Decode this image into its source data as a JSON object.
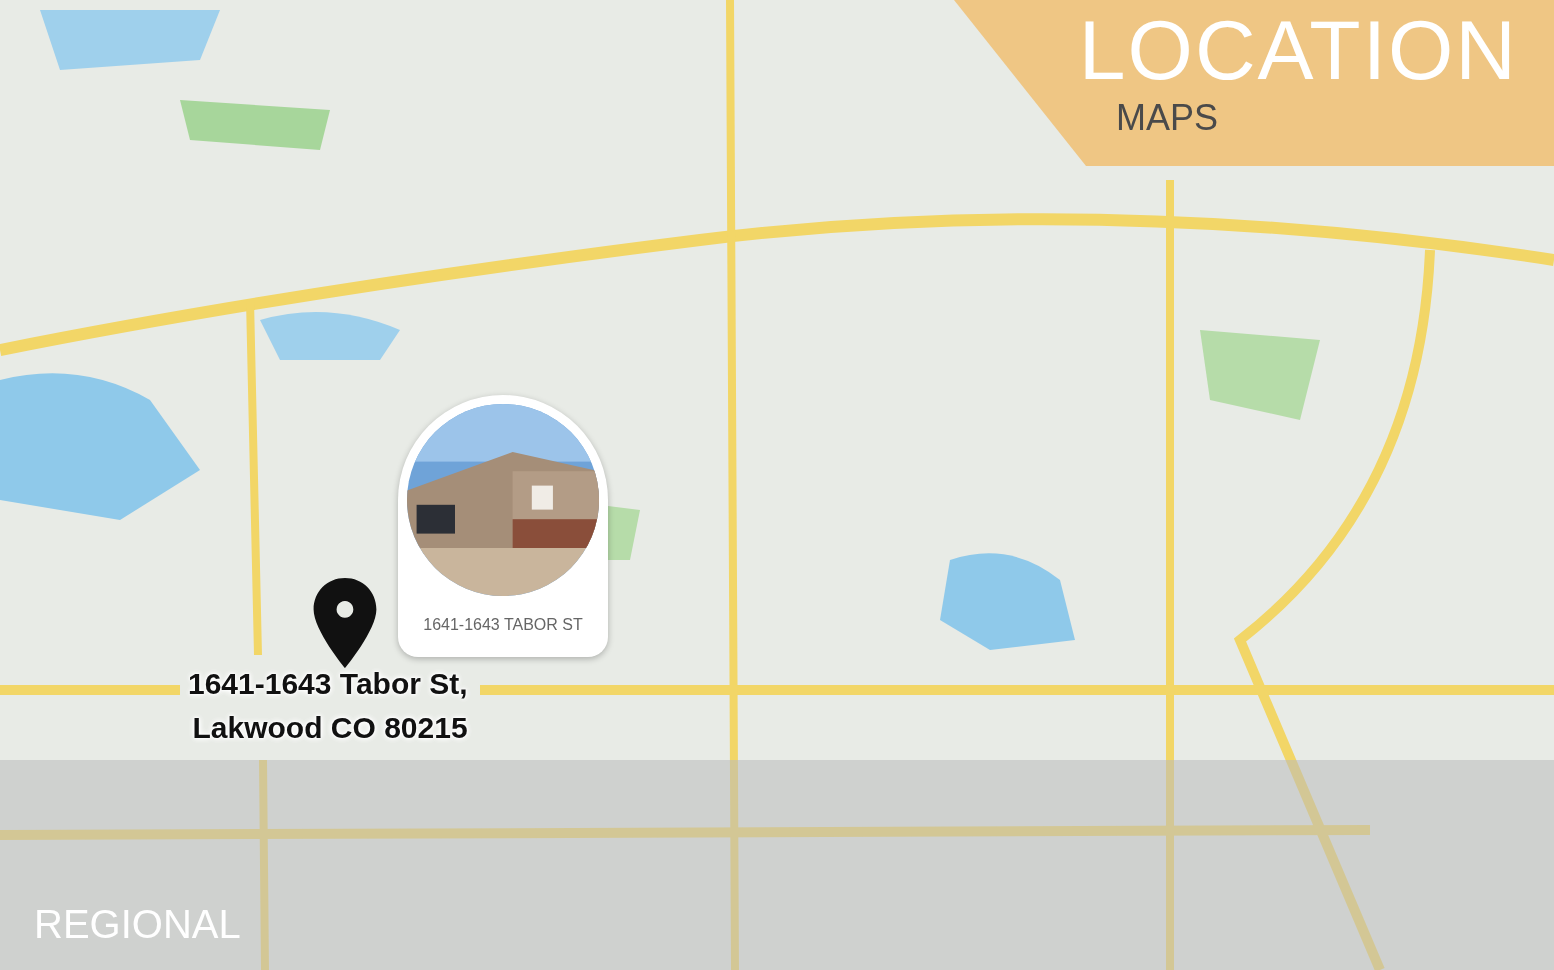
{
  "banner": {
    "title": "LOCATION",
    "subtitle": "MAPS"
  },
  "marker": {
    "label": "1641-1643 TABOR ST"
  },
  "address": [
    "1641-1643 Tabor St,",
    "Lakwood CO 80215"
  ],
  "footer": {
    "label": "REGIONAL"
  }
}
